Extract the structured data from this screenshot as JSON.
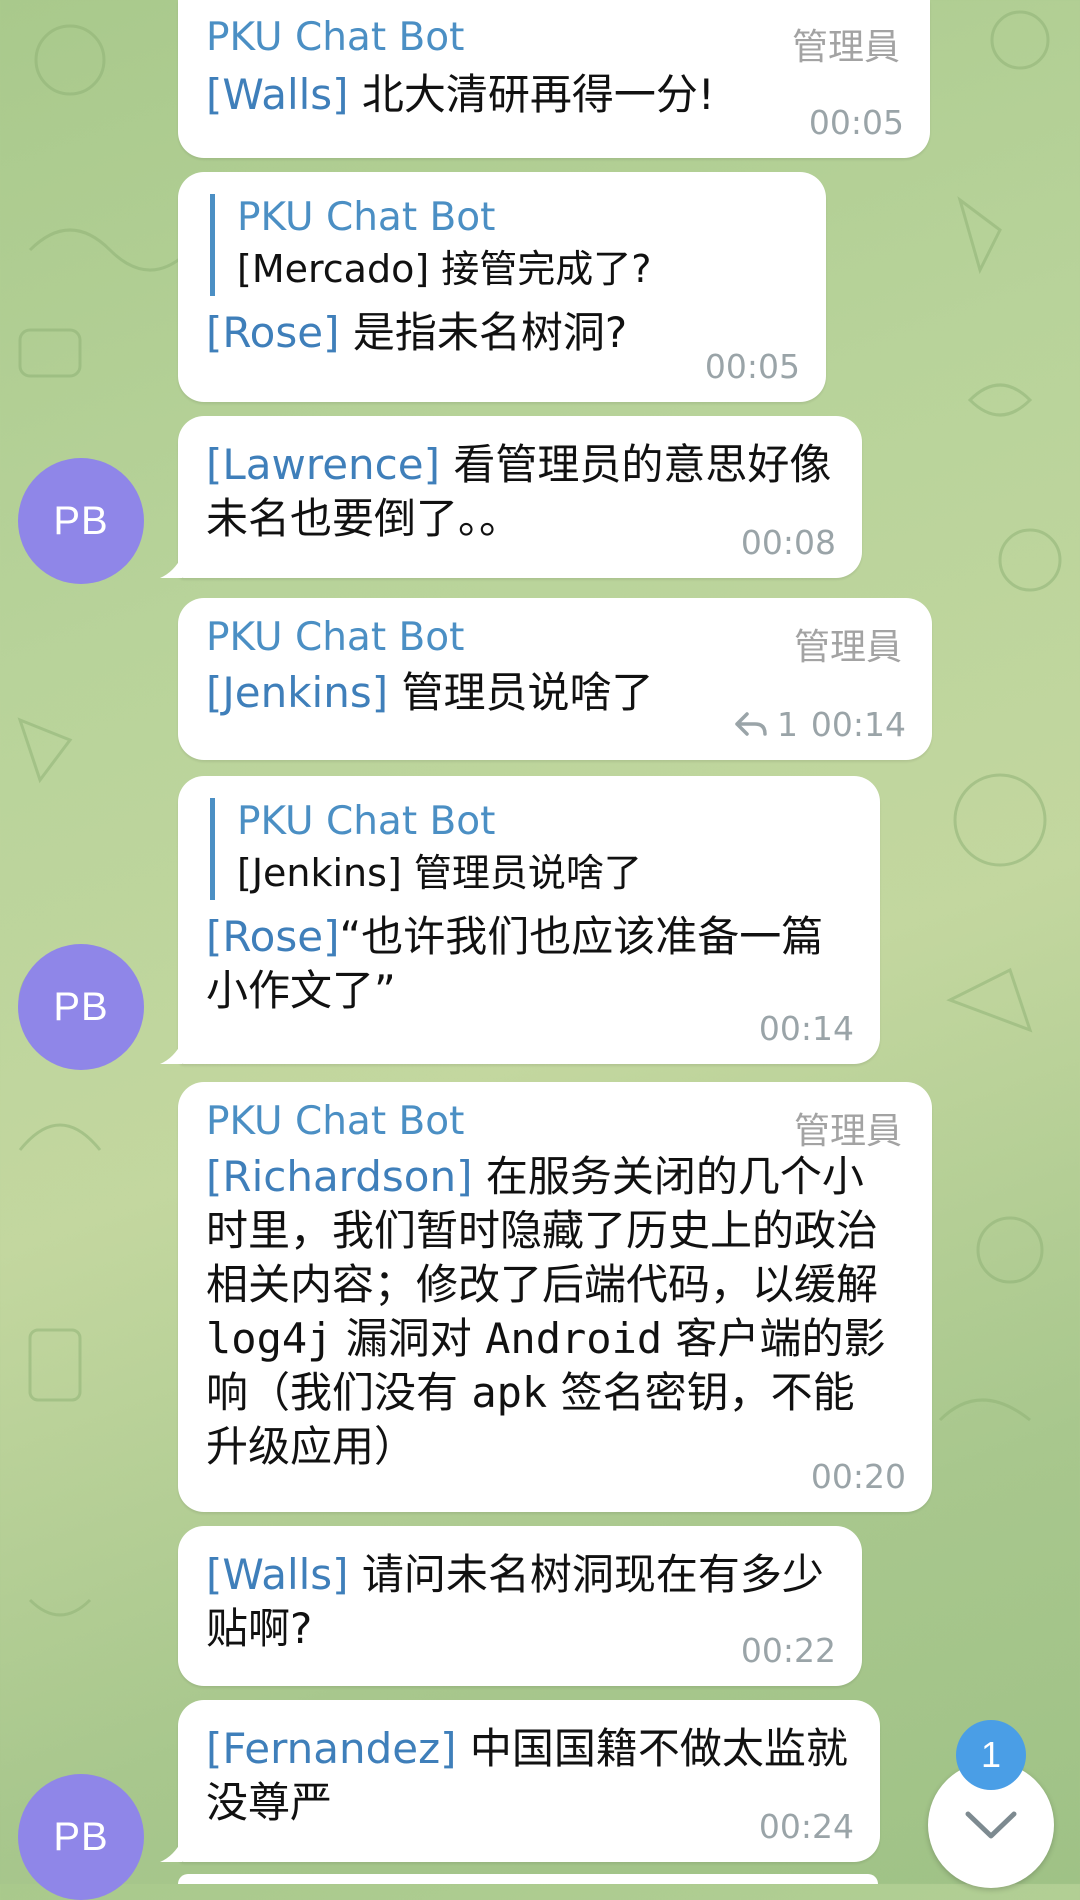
{
  "messages": [
    {
      "sender": "PKU Chat Bot",
      "role": "管理員",
      "tag": "[Walls]",
      "text": " 北大清研再得一分!",
      "time": "00:05"
    },
    {
      "quote_name": "PKU Chat Bot",
      "quote_text": "[Mercado] 接管完成了?",
      "tag": "[Rose]",
      "text": " 是指未名树洞?",
      "time": "00:05"
    },
    {
      "tag": "[Lawrence]",
      "text": " 看管理员的意思好像未名也要倒了。。",
      "time": "00:08",
      "avatar": "PB"
    },
    {
      "sender": "PKU Chat Bot",
      "role": "管理員",
      "tag": "[Jenkins]",
      "text": " 管理员说啥了",
      "reply_count": "1",
      "time": "00:14"
    },
    {
      "quote_name": "PKU Chat Bot",
      "quote_text": "[Jenkins] 管理员说啥了",
      "tag": "[Rose]",
      "text": "“也许我们也应该准备一篇小作文了”",
      "time": "00:14",
      "avatar": "PB"
    },
    {
      "sender": "PKU Chat Bot",
      "role": "管理員",
      "tag": "[Richardson]",
      "text_a": " 在服务关闭的几个小时里，我们暂时隐藏了历史上的政治相关内容；修改了后端代码，以缓解 ",
      "code1": "log4j",
      "text_b": " 漏洞对 ",
      "code2": "Android",
      "text_c": " 客户端的影响（我们没有 ",
      "code3": "apk",
      "text_d": " 签名密钥，不能升级应用）",
      "time": "00:20"
    },
    {
      "tag": "[Walls]",
      "text": " 请问未名树洞现在有多少贴啊?",
      "time": "00:22"
    },
    {
      "tag": "[Fernandez]",
      "text": " 中国国籍不做太监就没尊严",
      "time": "00:24",
      "avatar": "PB"
    }
  ],
  "scroll": {
    "unread_count": "1",
    "icon": "chevron-down-icon"
  },
  "colors": {
    "accent": "#4b8fc4",
    "avatar": "#8f86e8",
    "badge": "#4a9ee6"
  }
}
